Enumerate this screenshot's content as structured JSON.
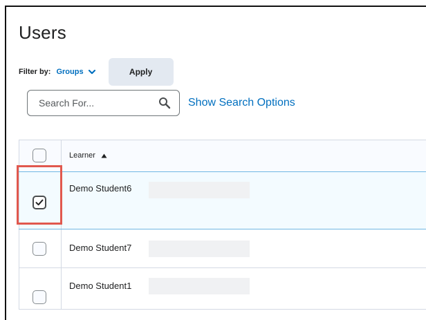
{
  "page": {
    "title": "Users"
  },
  "filter": {
    "label": "Filter by:",
    "groups_label": "Groups",
    "apply_label": "Apply"
  },
  "search": {
    "placeholder": "Search For...",
    "value": "",
    "options_label": "Show Search Options"
  },
  "table": {
    "header": {
      "column_label": "Learner",
      "sort": "ascending"
    },
    "rows": [
      {
        "name": "Demo Student6",
        "checked": true
      },
      {
        "name": "Demo Student7",
        "checked": false
      },
      {
        "name": "Demo Student1",
        "checked": false
      }
    ]
  },
  "colors": {
    "link_blue": "#006fbf",
    "selected_row": "#f3fbff",
    "highlight_red": "#e1584e",
    "apply_bg": "#e3e9f1"
  },
  "icons": {
    "groups_chevron": "chevron-down-icon",
    "search": "search-icon",
    "sort": "sort-ascending-icon",
    "checkmark": "checkmark-icon"
  }
}
